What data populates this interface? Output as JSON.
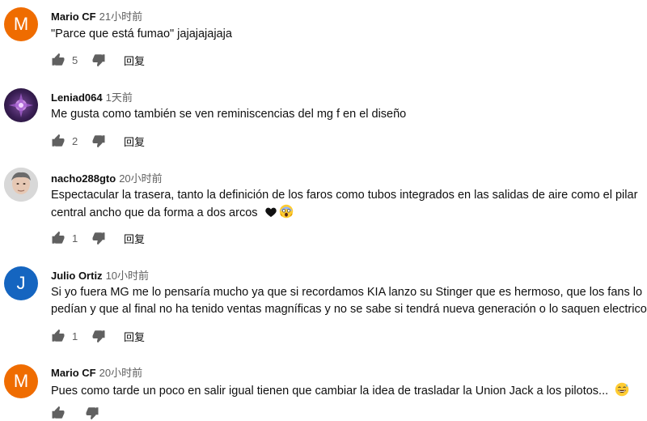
{
  "comments": [
    {
      "author": "Mario CF",
      "time": "21小时前",
      "avatar": {
        "type": "letter",
        "letter": "M",
        "color": "#ef6c00"
      },
      "text_lines": [
        "\"Parce que está fumao\" jajajajajaja"
      ],
      "likes": "5",
      "reply_label": "回复"
    },
    {
      "author": "Leniad064",
      "time": "1天前",
      "avatar": {
        "type": "image",
        "description": "dark purple emblem"
      },
      "text_lines": [
        "Me gusta como también se ven reminiscencias del mg f en el diseño"
      ],
      "likes": "2",
      "reply_label": "回复"
    },
    {
      "author": "nacho288gto",
      "time": "20小时前",
      "avatar": {
        "type": "image",
        "description": "face photo"
      },
      "text_lines": [
        "Espectacular la trasera, tanto la definición de los faros como tubos integrados en las salidas de aire como el pilar",
        "central ancho que da forma a dos arcos"
      ],
      "text_suffix_emojis": [
        "black-heart-emoji",
        "screaming-face-emoji"
      ],
      "likes": "1",
      "reply_label": "回复"
    },
    {
      "author": "Julio Ortiz",
      "time": "10小时前",
      "avatar": {
        "type": "letter",
        "letter": "J",
        "color": "#1565c0"
      },
      "text_lines": [
        "Si yo fuera MG me lo pensaría mucho ya que si recordamos KIA lanzo su Stinger que es hermoso, que los fans lo",
        "pedían y que al final no ha tenido ventas magníficas y no se sabe si tendrá nueva generación o lo saquen electrico"
      ],
      "likes": "1",
      "reply_label": "回复"
    },
    {
      "author": "Mario CF",
      "time": "20小时前",
      "avatar": {
        "type": "letter",
        "letter": "M",
        "color": "#ef6c00"
      },
      "text_lines": [
        "Pues como tarde un poco en salir igual tienen que cambiar la idea de trasladar la Union Jack a los pilotos..."
      ],
      "text_suffix_emojis": [
        "grinning-sweat-emoji"
      ],
      "likes": "",
      "reply_label": ""
    }
  ],
  "icons": {
    "like": "thumbs-up-icon",
    "dislike": "thumbs-down-icon"
  }
}
